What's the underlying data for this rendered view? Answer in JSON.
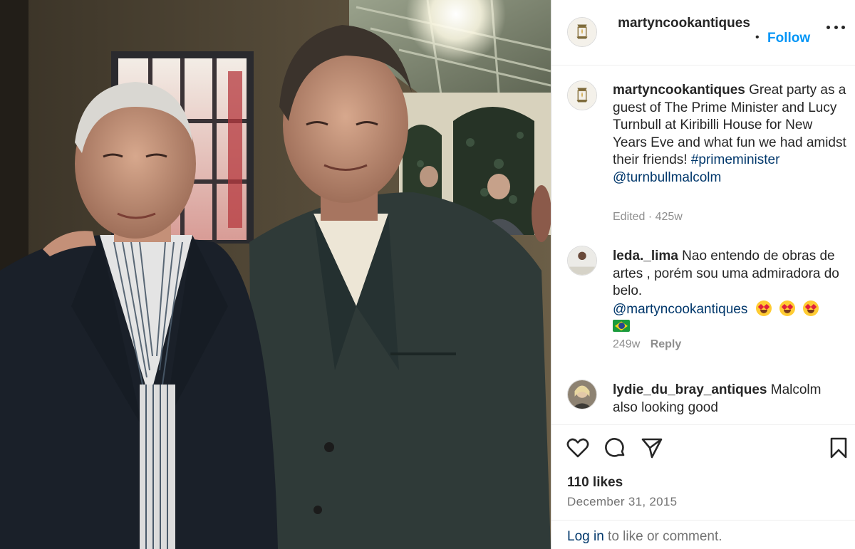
{
  "post": {
    "photo_alt": "",
    "author": "martyncookantiques",
    "follow_label": "Follow",
    "dot": "•"
  },
  "caption": {
    "user": "martyncookantiques",
    "text": "Great party as a guest of The Prime Minister and Lucy Turnbull at Kiribilli House for New Years Eve and what fun we had amidst their friends!",
    "hashtag": "#primeminister",
    "mention": "@turnbullmalcolm",
    "meta": "Edited · 425w"
  },
  "comments": [
    {
      "user": "leda._lima",
      "text": "Nao entendo de obras de artes , porém sou uma admiradora do belo.",
      "mention": "@martyncookantiques",
      "time": "249w",
      "reply_label": "Reply"
    },
    {
      "user": "lydie_du_bray_antiques",
      "text": "Malcolm also looking good"
    }
  ],
  "actions": {
    "icons": [
      "heart-icon",
      "comment-icon",
      "share-icon",
      "bookmark-icon"
    ]
  },
  "likes": "110 likes",
  "date": "December 31, 2015",
  "login": {
    "link": "Log in",
    "rest": " to like or comment."
  },
  "colors": {
    "link_blue": "#0095f6",
    "mention_blue": "#00376b",
    "meta_gray": "#8e8e8e"
  }
}
